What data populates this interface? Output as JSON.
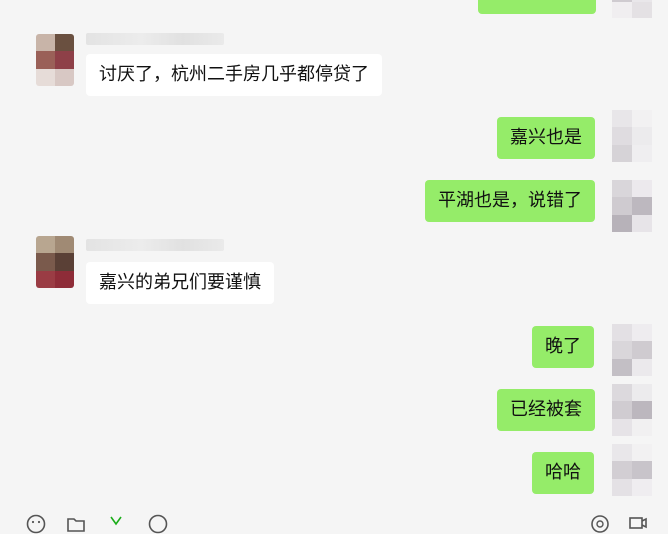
{
  "messages": [
    {
      "side": "left",
      "text": "讨厌了，杭州二手房几乎都停贷了"
    },
    {
      "side": "right",
      "text": "嘉兴也是"
    },
    {
      "side": "right",
      "text": "平湖也是，说错了"
    },
    {
      "side": "left",
      "text": "嘉兴的弟兄们要谨慎"
    },
    {
      "side": "right",
      "text": "晚了"
    },
    {
      "side": "right",
      "text": "已经被套"
    },
    {
      "side": "right",
      "text": "哈哈"
    }
  ],
  "colors": {
    "background": "#f5f5f5",
    "incoming_bubble": "#ffffff",
    "outgoing_bubble": "#95ec69"
  },
  "toolbar": {
    "icons": [
      "emoji-icon",
      "folder-icon",
      "scissors-icon",
      "chat-history-icon",
      "video-call-icon",
      "phone-icon"
    ]
  }
}
